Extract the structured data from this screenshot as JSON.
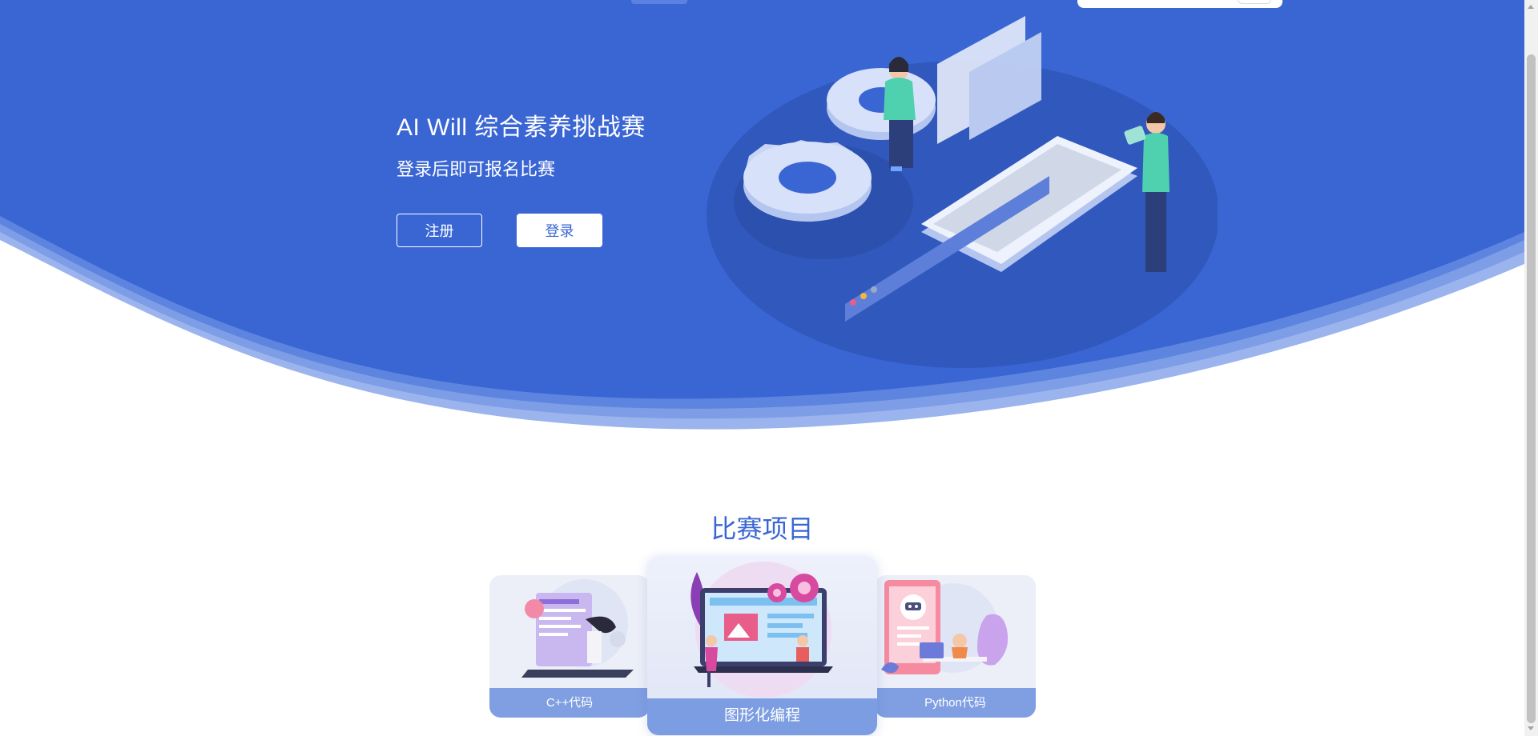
{
  "hero": {
    "title": "AI Will 综合素养挑战赛",
    "subtitle": "登录后即可报名比赛",
    "register_label": "注册",
    "login_label": "登录",
    "illustration": "gears-phone-people-illustration"
  },
  "section": {
    "title": "比赛项目"
  },
  "cards": [
    {
      "label": "C++代码",
      "image": "coding-laptop-illustration"
    },
    {
      "label": "图形化编程",
      "image": "graphic-programming-illustration"
    },
    {
      "label": "Python代码",
      "image": "robot-ai-illustration"
    }
  ],
  "colors": {
    "hero_blue": "#3a66d4",
    "wave_light": "#7f9fe2",
    "accent_text": "#3a66d4",
    "card_label_bg": "#7f9fe2"
  }
}
